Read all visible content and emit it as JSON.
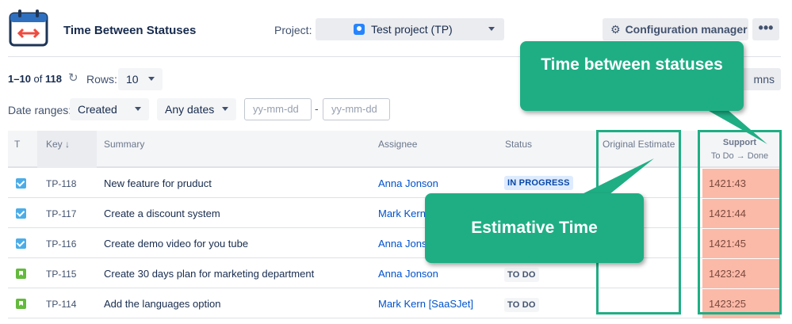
{
  "header": {
    "title": "Time Between Statuses",
    "project_label": "Project:",
    "project_value": "Test project (TP)",
    "config_button": "Configuration manager",
    "more_button": "•••"
  },
  "toolbar": {
    "range_start": "1–10",
    "range_of": "of",
    "total": "118",
    "rows_label": "Rows:",
    "rows_value": "10",
    "columns_button": "mns",
    "date_ranges_label": "Date ranges:",
    "created_select": "Created",
    "any_dates_select": "Any dates",
    "date_from_placeholder": "yy-mm-dd",
    "date_separator": "-",
    "date_to_placeholder": "yy-mm-dd"
  },
  "table": {
    "columns": {
      "type": "T",
      "key": "Key ↓",
      "summary": "Summary",
      "assignee": "Assignee",
      "status": "Status",
      "original_estimate": "Original Estimate",
      "support_title": "Support",
      "support_sub": "To Do → Done"
    },
    "rows": [
      {
        "type": "task",
        "key": "TP-118",
        "summary": "New feature for pruduct",
        "assignee": "Anna Jonson",
        "status": "IN PROGRESS",
        "status_kind": "progress",
        "estimate": "",
        "support": "1421:43"
      },
      {
        "type": "task",
        "key": "TP-117",
        "summary": "Create a discount system",
        "assignee": "Mark Kern",
        "status": "",
        "status_kind": "",
        "estimate": "",
        "support": "1421:44"
      },
      {
        "type": "task",
        "key": "TP-116",
        "summary": "Create demo video for you tube",
        "assignee": "Anna Jons",
        "status": "",
        "status_kind": "",
        "estimate": "",
        "support": "1421:45"
      },
      {
        "type": "story",
        "key": "TP-115",
        "summary": "Create 30 days plan for marketing department",
        "assignee": "Anna Jonson",
        "status": "TO DO",
        "status_kind": "todo",
        "estimate": "",
        "support": "1423:24"
      },
      {
        "type": "story",
        "key": "TP-114",
        "summary": "Add the languages option",
        "assignee": "Mark Kern [SaaSJet]",
        "status": "TO DO",
        "status_kind": "todo",
        "estimate": "",
        "support": "1423:25"
      }
    ]
  },
  "callouts": {
    "time_between": "Time between statuses",
    "estimative": "Estimative Time"
  },
  "colors": {
    "accent_green": "#1fae84",
    "support_fill": "#fbb9a8",
    "link_blue": "#0052cc"
  }
}
